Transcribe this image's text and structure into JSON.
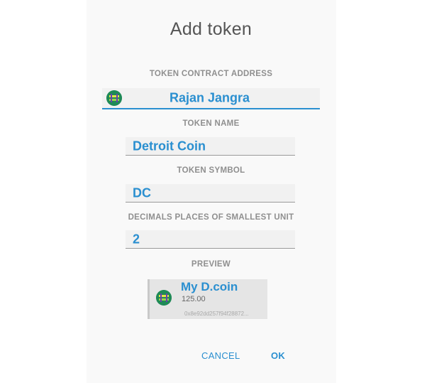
{
  "dialog": {
    "title": "Add token"
  },
  "contract_address": {
    "label": "TOKEN CONTRACT ADDRESS",
    "value": "Rajan Jangra"
  },
  "token_name": {
    "label": "TOKEN NAME",
    "value": "Detroit Coin"
  },
  "token_symbol": {
    "label": "TOKEN SYMBOL",
    "value": "DC"
  },
  "decimals": {
    "label": "DECIMALS PLACES OF SMALLEST UNIT",
    "value": "2"
  },
  "preview": {
    "label": "PREVIEW",
    "name": "My D.coin",
    "amount": "125.00",
    "address": "0x8e92dd257f94f28872..."
  },
  "actions": {
    "cancel": "CANCEL",
    "ok": "OK"
  },
  "icons": {
    "token_icon": "token-avatar-icon"
  },
  "colors": {
    "accent": "#2a8fd0",
    "label": "#8f8f8f",
    "title": "#555555"
  }
}
